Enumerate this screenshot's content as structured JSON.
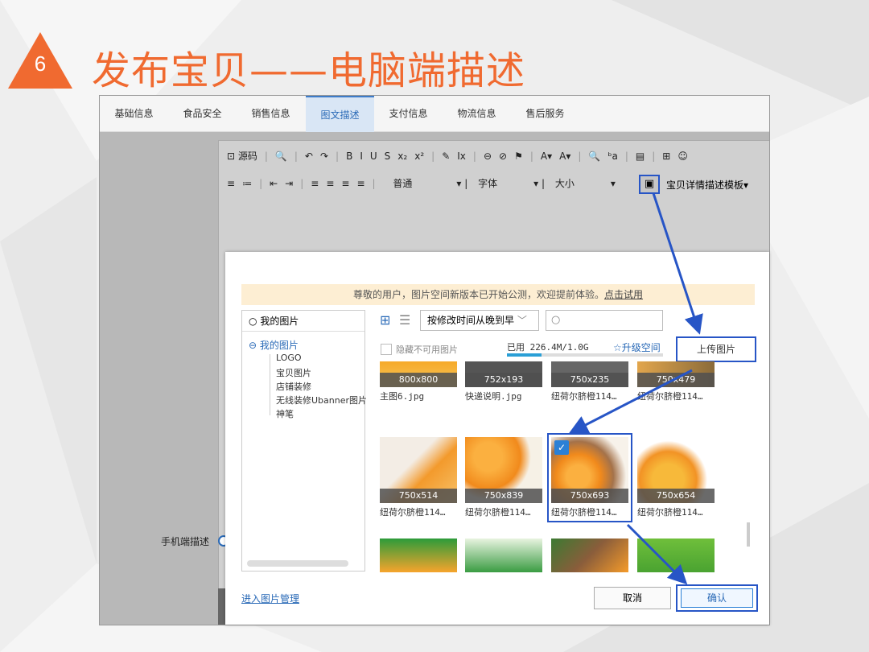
{
  "slide": {
    "number": "6",
    "title": "发布宝贝——电脑端描述"
  },
  "tabs": [
    {
      "label": "基础信息"
    },
    {
      "label": "食品安全"
    },
    {
      "label": "销售信息"
    },
    {
      "label": "图文描述",
      "active": true
    },
    {
      "label": "支付信息"
    },
    {
      "label": "物流信息"
    },
    {
      "label": "售后服务"
    }
  ],
  "toolbar": {
    "row1": [
      "⊡ 源码",
      "|",
      "🔍",
      "|",
      "↶",
      "↷",
      "|",
      "B",
      "I",
      "U",
      "S",
      "x₂",
      "x²",
      "|",
      "✎",
      "Ix",
      "|",
      "⊖",
      "⊘",
      "⚑",
      "|",
      "A▾",
      "A▾",
      "|",
      "🔍",
      "ᵇa",
      "|",
      "▤",
      "|",
      "⊞",
      "☺"
    ],
    "row2": [
      "≡",
      "≔",
      "|",
      "⇤",
      "⇥",
      "|",
      "≡",
      "≡",
      "≡",
      "≡",
      "|"
    ],
    "format": "普通",
    "font": "字体",
    "size": "大小",
    "template": "宝贝详情描述模板"
  },
  "mobile_label": "手机端描述",
  "dialog": {
    "notice_text": "尊敬的用户，图片空间新版本已开始公测，欢迎提前体验。",
    "notice_link": "点击试用",
    "left_search": "我的图片",
    "tree_root": "我的图片",
    "tree_items": [
      "LOGO",
      "宝贝图片",
      "店铺装修",
      "无线装修Ubanner图片",
      "神笔"
    ],
    "sort_label": "按修改时间从晚到早",
    "hide_label": "隐藏不可用图片",
    "usage_text": "已用  226.4M/1.0G",
    "usage_fraction": 0.22,
    "upgrade_label": "升级空间",
    "upload_label": "上传图片",
    "images_row1": [
      {
        "dim": "800x800",
        "name": "主图6.jpg"
      },
      {
        "dim": "752x193",
        "name": "快递说明.jpg"
      },
      {
        "dim": "750x235",
        "name": "纽荷尔脐橙114…"
      },
      {
        "dim": "750x479",
        "name": "纽荷尔脐橙114…"
      }
    ],
    "images_row2": [
      {
        "dim": "750x514",
        "name": "纽荷尔脐橙114…"
      },
      {
        "dim": "750x839",
        "name": "纽荷尔脐橙114…"
      },
      {
        "dim": "750x693",
        "name": "纽荷尔脐橙114…",
        "selected": true
      },
      {
        "dim": "750x654",
        "name": "纽荷尔脐橙114…"
      }
    ],
    "manage_link": "进入图片管理",
    "cancel_label": "取消",
    "confirm_label": "确认"
  },
  "colors": {
    "accent": "#f06a30",
    "highlight": "#2755c6",
    "link": "#2a6ab7"
  }
}
